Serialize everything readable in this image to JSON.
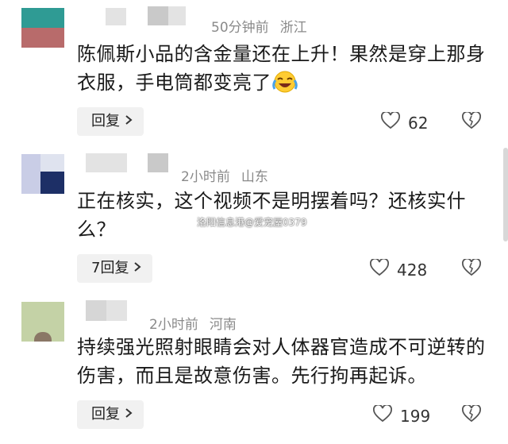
{
  "comments": [
    {
      "time": "50分钟前",
      "location": "浙江",
      "text": "陈佩斯小品的含金量还在上升！果然是穿上那身衣服，手电筒都变亮了",
      "reply_label": "回复",
      "likes": "62",
      "avatar_colors": [
        "#2f9b94",
        "#b86b6b"
      ]
    },
    {
      "time": "2小时前",
      "location": "山东",
      "text": "正在核实，这个视频不是明摆着吗？还核实什么？",
      "reply_label": "7回复",
      "likes": "428",
      "avatar_colors": [
        "#1d2f66",
        "#dfe3ef"
      ]
    },
    {
      "time": "2小时前",
      "location": "河南",
      "text": "持续强光照射眼睛会对人体器官造成不可逆转的伤害，而且是故意伤害。先行拘再起诉。",
      "reply_label": "回复",
      "likes": "199",
      "avatar_colors": [
        "#c4d2a6",
        "#8a7766"
      ]
    }
  ],
  "watermark": "洛阳信息港@爱宠屋0379",
  "icons": {
    "like": "heart-outline-icon",
    "dislike": "broken-heart-icon",
    "emoji": "laughing-crying-emoji-icon",
    "chevron": "chevron-right-icon"
  }
}
